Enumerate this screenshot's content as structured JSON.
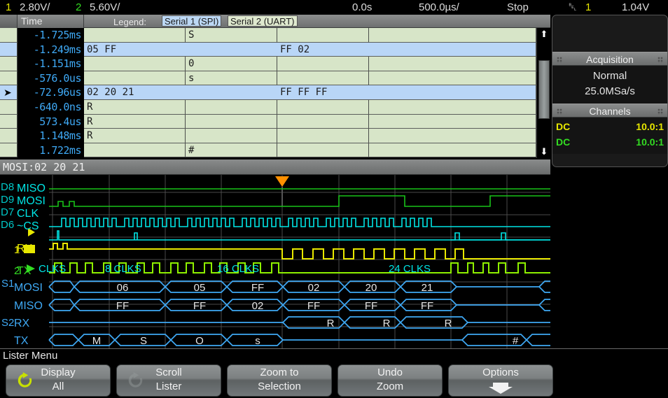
{
  "topbar": {
    "ch1_num": "1",
    "ch1_scale": "2.80V/",
    "ch2_num": "2",
    "ch2_scale": "5.60V/",
    "delay": "0.0s",
    "timebase": "500.0µs/",
    "run_state": "Stop",
    "trigger_icon": "trigger-edge-icon",
    "trigger_source": "1",
    "trigger_level": "1.04V"
  },
  "lister": {
    "col_marker": "",
    "col_time": "Time",
    "legend_label": "Legend:",
    "serial1": "Serial 1 (SPI)",
    "serial2": "Serial 2 (UART)",
    "rows": [
      {
        "time": "-1.725ms",
        "selected": false,
        "marker": false,
        "kind": "cells",
        "cells": [
          "",
          "S",
          "",
          ""
        ]
      },
      {
        "time": "-1.249ms",
        "selected": true,
        "marker": false,
        "kind": "wide",
        "spi": "05 FF",
        "uart": "FF 02"
      },
      {
        "time": "-1.151ms",
        "selected": false,
        "marker": false,
        "kind": "cells",
        "cells": [
          "",
          "0",
          "",
          ""
        ]
      },
      {
        "time": "-576.0us",
        "selected": false,
        "marker": false,
        "kind": "cells",
        "cells": [
          "",
          "s",
          "",
          ""
        ]
      },
      {
        "time": "-72.96us",
        "selected": true,
        "marker": true,
        "kind": "wide",
        "spi": "02 20 21",
        "uart": "FF FF FF"
      },
      {
        "time": "-640.0ns",
        "selected": false,
        "marker": false,
        "kind": "cells",
        "cells": [
          "R",
          "",
          "",
          ""
        ]
      },
      {
        "time": "573.4us",
        "selected": false,
        "marker": false,
        "kind": "cells",
        "cells": [
          "R",
          "",
          "",
          ""
        ]
      },
      {
        "time": "1.148ms",
        "selected": false,
        "marker": false,
        "kind": "cells",
        "cells": [
          "R",
          "",
          "",
          ""
        ]
      },
      {
        "time": "1.722ms",
        "selected": false,
        "marker": false,
        "kind": "cells",
        "cells": [
          "",
          "#",
          "",
          ""
        ]
      }
    ],
    "scroll_up_icon": "scroll-up-arrow-icon",
    "scroll_down_icon": "scroll-down-arrow-icon"
  },
  "sidebar": {
    "acquisition_title": "Acquisition",
    "acquisition_mode": "Normal",
    "sample_rate": "25.0MSa/s",
    "channels_title": "Channels",
    "channels": [
      {
        "coupling": "DC",
        "probe": "10.0:1",
        "color": "#e8e800"
      },
      {
        "coupling": "DC",
        "probe": "10.0:1",
        "color": "#33dd22"
      }
    ]
  },
  "decode_bar": {
    "text": "MOSI:02 20 21"
  },
  "waveform": {
    "digital_labels": [
      "D8",
      "D9",
      "D7",
      "D6"
    ],
    "analog_labels": [
      "1",
      "2"
    ],
    "serial_labels": [
      "S1",
      "S2"
    ],
    "signal_names": [
      "MISO",
      "MOSI",
      "CLK",
      "~CS",
      "RX",
      "TX"
    ],
    "clk_annotations": [
      "CLKS",
      "8 CLKS",
      "16 CLKS",
      "24 CLKS"
    ],
    "bus_rows": [
      {
        "name": "MOSI",
        "values": [
          "06",
          "05",
          "FF",
          "02",
          "20",
          "21"
        ]
      },
      {
        "name": "MISO",
        "values": [
          "FF",
          "FF",
          "02",
          "FF",
          "FF",
          "FF"
        ]
      },
      {
        "name": "RX",
        "values": [
          "R",
          "R",
          "R"
        ]
      },
      {
        "name": "TX",
        "values": [
          "M",
          "S",
          "O",
          "s",
          "#"
        ]
      }
    ],
    "bus_prefix_mosi": "MOSI",
    "bus_prefix_miso": "MISO",
    "bus_prefix_rx": "RX",
    "bus_prefix_tx": "TX",
    "trigger_marker_icon": "trigger-position-marker-icon",
    "colors": {
      "digital": "#00e5e5",
      "ch1": "#e8e800",
      "ch2": "#33dd22",
      "serial_bus": "#3fa9f5",
      "trigger": "#ff9000",
      "grid": "#4a4a4a"
    }
  },
  "menu": {
    "title": "Lister Menu",
    "keys": [
      {
        "line1": "Display",
        "line2": "All",
        "icon": "refresh-icon",
        "icon_active": true
      },
      {
        "line1": "Scroll",
        "line2": "Lister",
        "icon": "refresh-icon",
        "icon_active": false
      },
      {
        "line1": "Zoom to",
        "line2": "Selection",
        "icon": "",
        "icon_active": false
      },
      {
        "line1": "Undo",
        "line2": "Zoom",
        "icon": "",
        "icon_active": false
      },
      {
        "line1": "Options",
        "line2": "",
        "icon": "down-arrow-icon",
        "icon_active": false
      }
    ]
  }
}
